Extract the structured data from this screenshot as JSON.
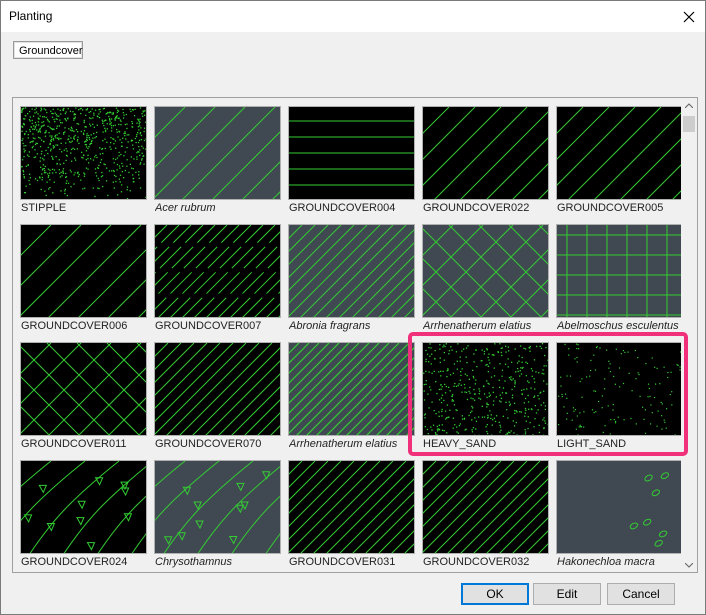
{
  "window": {
    "title": "Planting"
  },
  "tabs": [
    {
      "label": "Groundcover"
    }
  ],
  "colors": {
    "pattern_green": "#33cc33",
    "bg_black": "#000000",
    "bg_slate": "#404852",
    "highlight": "#f0307a",
    "default_button_border": "#0078d7"
  },
  "items": [
    {
      "label": "STIPPLE",
      "italic": false,
      "bg": "black",
      "pattern": "stipple-gradient"
    },
    {
      "label": "Acer rubrum",
      "italic": true,
      "bg": "slate",
      "pattern": "diagonal-sparse"
    },
    {
      "label": "GROUNDCOVER004",
      "italic": false,
      "bg": "black",
      "pattern": "horizontal-lines"
    },
    {
      "label": "GROUNDCOVER022",
      "italic": false,
      "bg": "black",
      "pattern": "diagonal"
    },
    {
      "label": "GROUNDCOVER005",
      "italic": false,
      "bg": "black",
      "pattern": "diagonal"
    },
    {
      "label": "GROUNDCOVER006",
      "italic": false,
      "bg": "black",
      "pattern": "diagonal-sparse"
    },
    {
      "label": "GROUNDCOVER007",
      "italic": false,
      "bg": "black",
      "pattern": "diagonal-dashed"
    },
    {
      "label": "Abronia fragrans",
      "italic": true,
      "bg": "slate",
      "pattern": "diagonal-dense"
    },
    {
      "label": "Arrhenatherum elatius",
      "italic": true,
      "bg": "slate",
      "pattern": "crosshatch"
    },
    {
      "label": "Abelmoschus esculentus",
      "italic": true,
      "bg": "slate",
      "pattern": "grid"
    },
    {
      "label": "GROUNDCOVER011",
      "italic": false,
      "bg": "black",
      "pattern": "crosshatch"
    },
    {
      "label": "GROUNDCOVER070",
      "italic": false,
      "bg": "black",
      "pattern": "diagonal-dense"
    },
    {
      "label": "Arrhenatherum elatius",
      "italic": true,
      "bg": "slate",
      "pattern": "diagonal-dense-bright"
    },
    {
      "label": "HEAVY_SAND",
      "italic": false,
      "bg": "black",
      "pattern": "dots-heavy"
    },
    {
      "label": "LIGHT_SAND",
      "italic": false,
      "bg": "black",
      "pattern": "dots-light"
    },
    {
      "label": "GROUNDCOVER024",
      "italic": false,
      "bg": "black",
      "pattern": "wavy-triangles"
    },
    {
      "label": "Chrysothamnus",
      "italic": true,
      "bg": "slate",
      "pattern": "wavy-triangles"
    },
    {
      "label": "GROUNDCOVER031",
      "italic": false,
      "bg": "black",
      "pattern": "diagonal-dense"
    },
    {
      "label": "GROUNDCOVER032",
      "italic": false,
      "bg": "black",
      "pattern": "diagonal-dense"
    },
    {
      "label": "Hakonechloa macra",
      "italic": true,
      "bg": "slate",
      "pattern": "ovals"
    }
  ],
  "selection": {
    "highlighted": [
      "HEAVY_SAND",
      "LIGHT_SAND"
    ]
  },
  "buttons": {
    "ok": "OK",
    "edit": "Edit",
    "cancel": "Cancel"
  }
}
